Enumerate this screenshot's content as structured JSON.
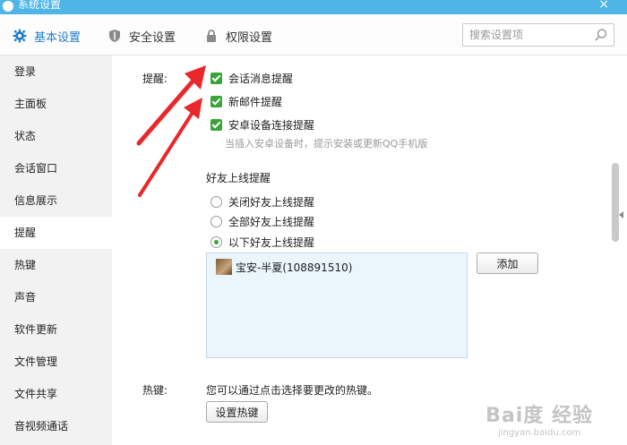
{
  "window": {
    "title": "系统设置",
    "close_label": "×"
  },
  "tabs": [
    {
      "label": "基本设置",
      "icon": "gear-icon",
      "active": true
    },
    {
      "label": "安全设置",
      "icon": "shield-icon",
      "active": false
    },
    {
      "label": "权限设置",
      "icon": "lock-icon",
      "active": false
    }
  ],
  "search": {
    "placeholder": "搜索设置项",
    "icon": "search-icon"
  },
  "sidebar": {
    "items": [
      {
        "label": "登录"
      },
      {
        "label": "主面板"
      },
      {
        "label": "状态"
      },
      {
        "label": "会话窗口"
      },
      {
        "label": "信息展示"
      },
      {
        "label": "提醒",
        "active": true
      },
      {
        "label": "热键"
      },
      {
        "label": "声音"
      },
      {
        "label": "软件更新"
      },
      {
        "label": "文件管理"
      },
      {
        "label": "文件共享"
      },
      {
        "label": "音视频通话"
      }
    ]
  },
  "reminder": {
    "section_label": "提醒:",
    "checkboxes": [
      {
        "label": "会话消息提醒",
        "checked": true
      },
      {
        "label": "新邮件提醒",
        "checked": true
      },
      {
        "label": "安卓设备连接提醒",
        "checked": true
      }
    ],
    "android_hint": "当插入安卓设备时，提示安装或更新QQ手机版",
    "friend_online": {
      "title": "好友上线提醒",
      "options": [
        {
          "label": "关闭好友上线提醒",
          "selected": false
        },
        {
          "label": "全部好友上线提醒",
          "selected": false
        },
        {
          "label": "以下好友上线提醒",
          "selected": true
        }
      ],
      "friends": [
        {
          "name": "宝安-半夏(108891510)"
        }
      ],
      "add_button": "添加"
    }
  },
  "hotkey": {
    "section_label": "热键:",
    "description": "您可以通过点击选择要更改的热键。",
    "button": "设置热键"
  },
  "colors": {
    "titlebar": "#4fb4e6",
    "accent": "#1e7fc9",
    "checkbox_green": "#3aa33a",
    "annotation_red": "#e8282b"
  },
  "watermark": {
    "main": "Bai度 经验",
    "sub": "jingyan.baidu.com"
  }
}
